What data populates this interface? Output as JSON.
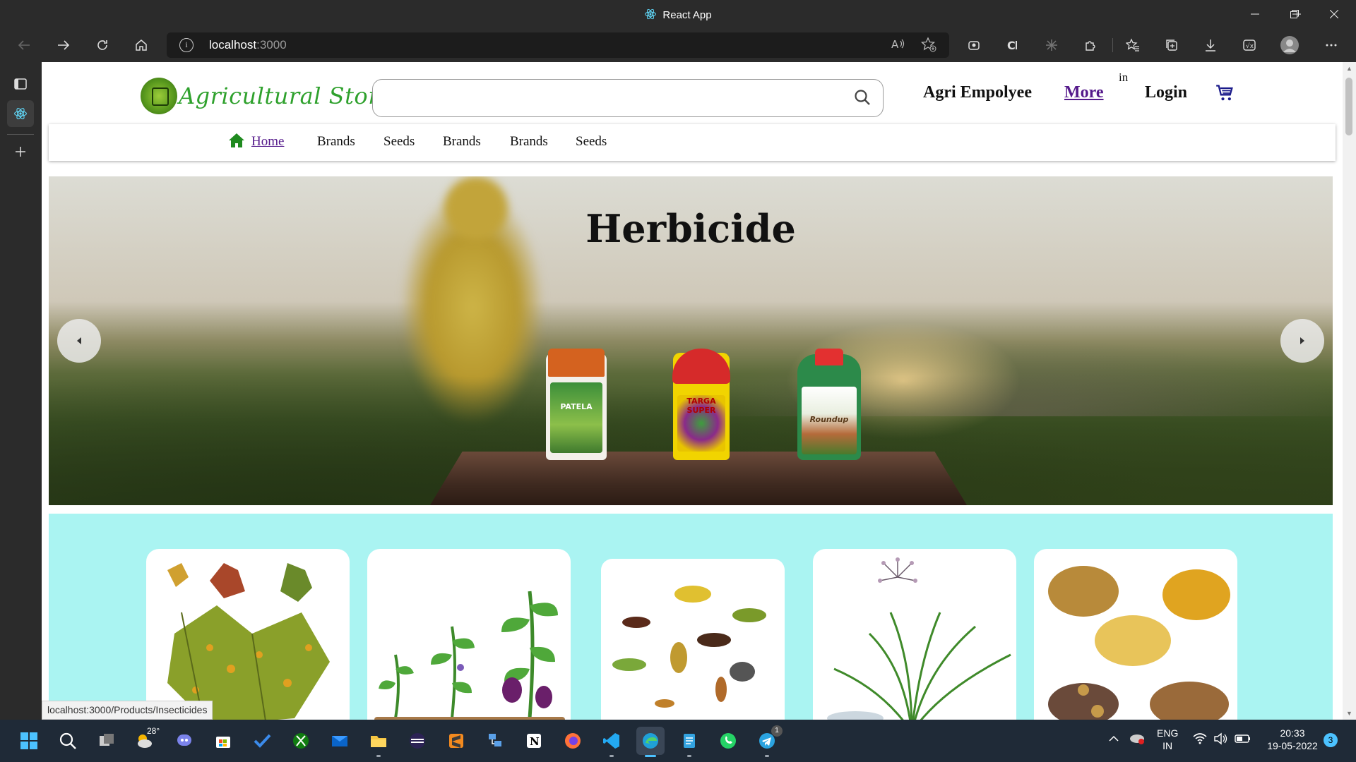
{
  "window": {
    "title": "React App"
  },
  "toolbar": {
    "url_host": "localhost",
    "url_port": ":3000"
  },
  "header": {
    "logo_text": "Agricultural Store",
    "search_placeholder": "",
    "agri_employee": "Agri Empolyee",
    "more": "More",
    "superscript_in": "in",
    "login": "Login"
  },
  "nav": {
    "items": [
      "Home",
      "Brands",
      "Seeds",
      "Brands",
      "Brands",
      "Seeds"
    ]
  },
  "banner": {
    "headline": "Herbicide",
    "products": [
      "PATELA",
      "TARGA SUPER",
      "Roundup"
    ]
  },
  "categories": {
    "cards": [
      "leaf-disease",
      "plant-growth",
      "insects",
      "weeds",
      "seeds"
    ]
  },
  "status_bar": {
    "url": "localhost:3000/Products/Insecticides"
  },
  "taskbar": {
    "weather_temp": "28°",
    "lang_top": "ENG",
    "lang_bottom": "IN",
    "time": "20:33",
    "date": "19-05-2022",
    "notification_count": "3",
    "telegram_badge": "1"
  },
  "colors": {
    "logo_green": "#2fa12d",
    "link_visited": "#551a8b",
    "category_bg": "#aaf4f2",
    "browser_chrome": "#2b2b2b",
    "taskbar": "#1f2a37"
  }
}
